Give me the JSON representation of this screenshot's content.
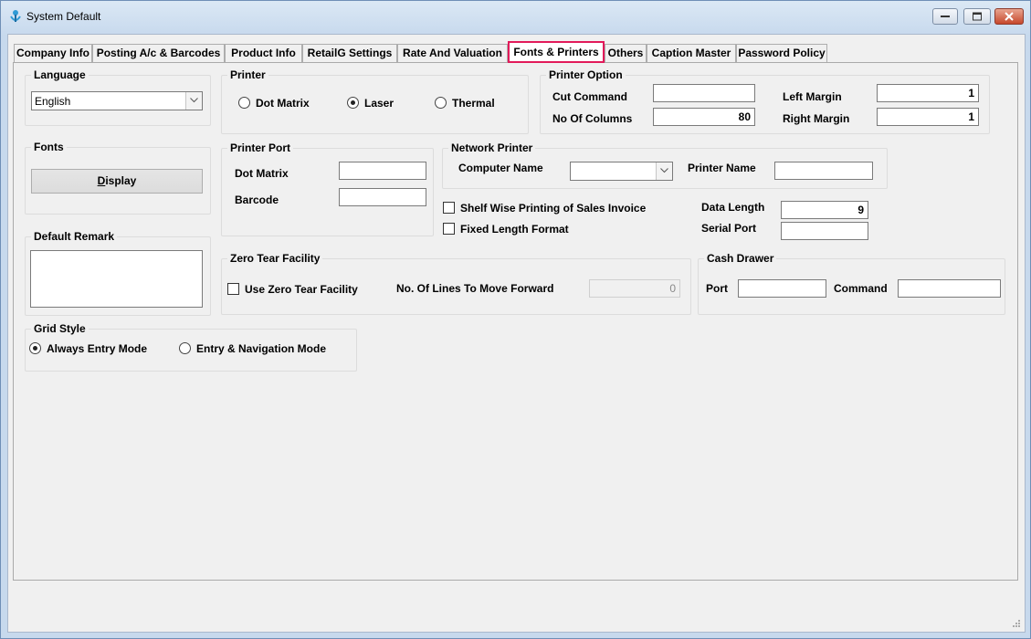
{
  "window": {
    "title": "System Default"
  },
  "tabs": [
    {
      "label": "Company Info"
    },
    {
      "label": "Posting A/c & Barcodes"
    },
    {
      "label": "Product Info"
    },
    {
      "label": "RetailG Settings"
    },
    {
      "label": "Rate And Valuation"
    },
    {
      "label": "Fonts & Printers",
      "active": true
    },
    {
      "label": "Others"
    },
    {
      "label": "Caption Master"
    },
    {
      "label": "Password Policy"
    }
  ],
  "language": {
    "title": "Language",
    "selected": "English"
  },
  "fonts": {
    "title": "Fonts",
    "display_underline": "D",
    "display_rest": "isplay"
  },
  "default_remark": {
    "title": "Default Remark",
    "value": ""
  },
  "grid_style": {
    "title": "Grid Style",
    "options": [
      {
        "label": "Always Entry Mode",
        "selected": true
      },
      {
        "label": "Entry & Navigation Mode",
        "selected": false
      }
    ]
  },
  "printer": {
    "title": "Printer",
    "options": [
      {
        "label": "Dot Matrix",
        "selected": false
      },
      {
        "label": "Laser",
        "selected": true
      },
      {
        "label": "Thermal",
        "selected": false
      }
    ]
  },
  "printer_port": {
    "title": "Printer Port",
    "dot_matrix_label": "Dot Matrix",
    "dot_matrix_value": "",
    "barcode_label": "Barcode",
    "barcode_value": ""
  },
  "printer_option": {
    "title": "Printer Option",
    "cut_command_label": "Cut Command",
    "cut_command_value": "",
    "no_of_columns_label": "No Of Columns",
    "no_of_columns_value": "80",
    "left_margin_label": "Left Margin",
    "left_margin_value": "1",
    "right_margin_label": "Right Margin",
    "right_margin_value": "1"
  },
  "network_printer": {
    "title": "Network Printer",
    "computer_name_label": "Computer Name",
    "computer_name_value": "",
    "printer_name_label": "Printer Name",
    "printer_name_value": ""
  },
  "sales": {
    "shelf_wise_label": "Shelf Wise Printing of Sales Invoice",
    "shelf_wise_checked": false,
    "fixed_length_label": "Fixed Length Format",
    "fixed_length_checked": false,
    "data_length_label": "Data Length",
    "data_length_value": "9",
    "serial_port_label": "Serial Port",
    "serial_port_value": ""
  },
  "zero_tear": {
    "title": "Zero Tear Facility",
    "use_label": "Use Zero Tear Facility",
    "use_checked": false,
    "lines_label": "No. Of Lines To Move Forward",
    "lines_value": "0"
  },
  "cash_drawer": {
    "title": "Cash Drawer",
    "port_label": "Port",
    "port_value": "",
    "command_label": "Command",
    "command_value": ""
  },
  "colors": {
    "active_tab_border": "#e21a5a",
    "close_button": "#c7472b"
  }
}
